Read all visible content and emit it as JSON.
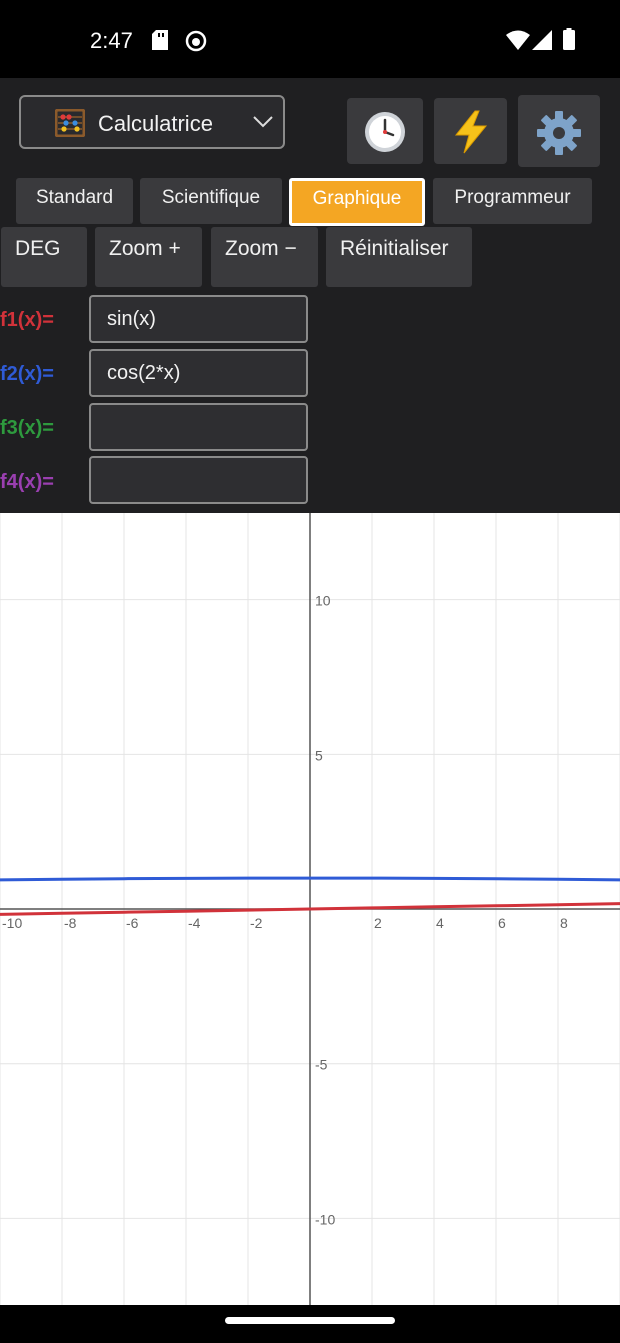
{
  "status": {
    "time": "2:47"
  },
  "header": {
    "mode_label": "Calculatrice",
    "mode_icon": "abacus-icon",
    "history_icon": "clock-icon",
    "quick_icon": "lightning-icon",
    "settings_icon": "gear-icon"
  },
  "tabs": [
    {
      "label": "Standard",
      "active": false
    },
    {
      "label": "Scientifique",
      "active": false
    },
    {
      "label": "Graphique",
      "active": true
    },
    {
      "label": "Programmeur",
      "active": false
    }
  ],
  "toolbar": {
    "angle_label": "DEG",
    "zoom_in_label": "Zoom +",
    "zoom_out_label": "Zoom −",
    "reset_label": "Réinitialiser"
  },
  "functions": [
    {
      "label": "f1(x)=",
      "value": "sin(x)",
      "color": "#d1323a"
    },
    {
      "label": "f2(x)=",
      "value": "cos(2*x)",
      "color": "#2f5bd6"
    },
    {
      "label": "f3(x)=",
      "value": "",
      "color": "#2e9a3e"
    },
    {
      "label": "f4(x)=",
      "value": "",
      "color": "#9a3fb0"
    }
  ],
  "colors": {
    "accent": "#f4a623",
    "panel": "#1f1f21",
    "button": "#3a3a3d"
  },
  "chart_data": {
    "type": "line",
    "xlim": [
      -10,
      10
    ],
    "ylim": [
      -12.8,
      12.8
    ],
    "x_ticks": [
      -10,
      -8,
      -6,
      -4,
      -2,
      2,
      4,
      6,
      8
    ],
    "y_ticks": [
      10,
      5,
      -5,
      -10
    ],
    "grid": true,
    "series": [
      {
        "name": "f1(x)=",
        "expression": "sin(x)",
        "color": "#d1323a",
        "x": [
          -10,
          -8,
          -6,
          -4,
          -2,
          0,
          2,
          4,
          6,
          8,
          10
        ],
        "y": [
          -0.174,
          -0.139,
          -0.105,
          -0.07,
          -0.035,
          0,
          0.035,
          0.07,
          0.105,
          0.139,
          0.174
        ]
      },
      {
        "name": "f2(x)=",
        "expression": "cos(2*x)",
        "color": "#2f5bd6",
        "x": [
          -10,
          -8,
          -6,
          -4,
          -2,
          0,
          2,
          4,
          6,
          8,
          10
        ],
        "y": [
          0.94,
          0.961,
          0.978,
          0.99,
          0.998,
          1.0,
          0.998,
          0.99,
          0.978,
          0.961,
          0.94
        ]
      }
    ]
  }
}
